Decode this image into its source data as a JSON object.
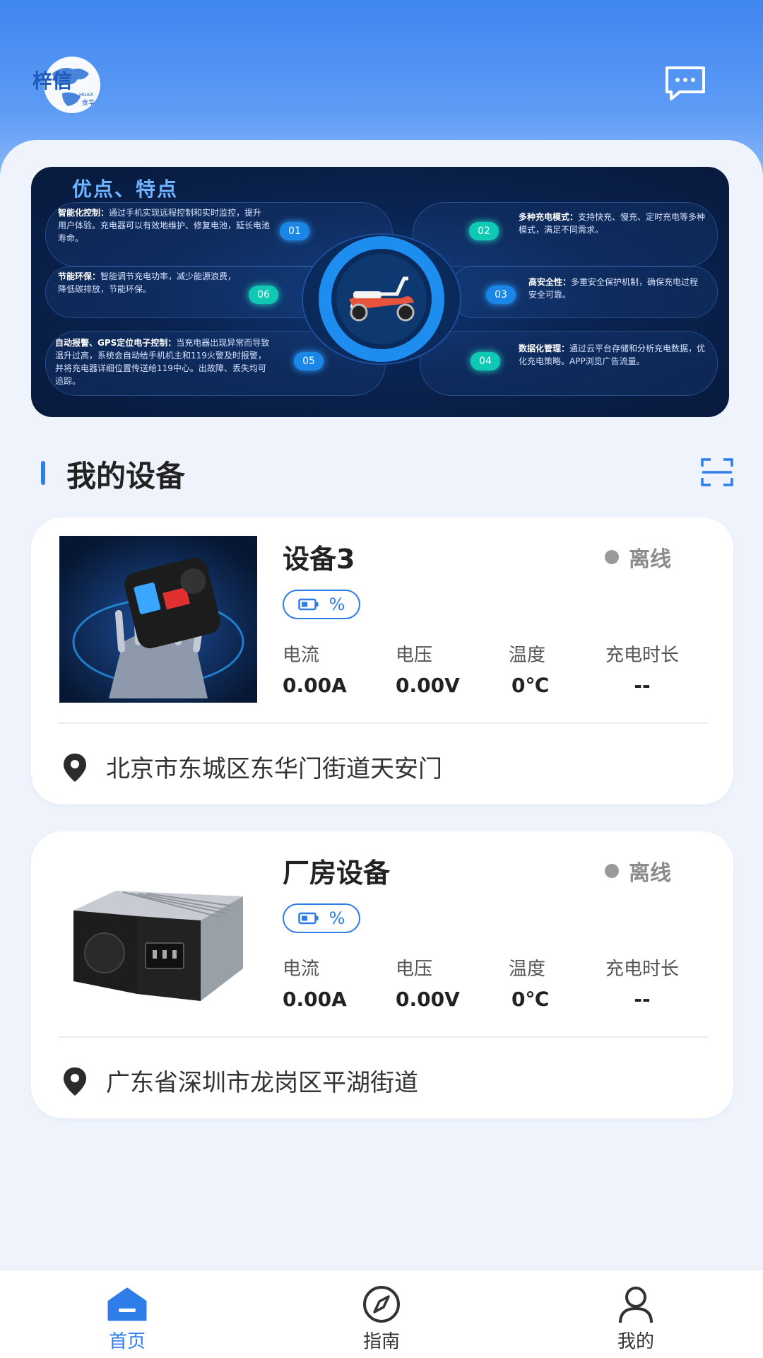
{
  "header": {
    "logo_text": "梓信",
    "logo_subtext": "HUAX 金华"
  },
  "banner": {
    "title": "优点、特点",
    "features": [
      {
        "num": "01",
        "name": "智能化控制：",
        "text": "通过手机实现远程控制和实时监控，提升用户体验。充电器可以有效地维护、修复电池，延长电池寿命。"
      },
      {
        "num": "02",
        "name": "多种充电模式：",
        "text": "支持快充、慢充、定时充电等多种模式，满足不同需求。"
      },
      {
        "num": "03",
        "name": "高安全性：",
        "text": "多重安全保护机制，确保充电过程安全可靠。"
      },
      {
        "num": "04",
        "name": "数据化管理：",
        "text": "通过云平台存储和分析充电数据，优化充电策略。APP浏览广告流量。"
      },
      {
        "num": "05",
        "name": "自动报警、GPS定位电子控制：",
        "text": "当充电器出现异常而导致温升过高，系统会自动给手机机主和119火警及时报警，并将充电器详细位置传送给119中心。出故障、丢失均可追踪。"
      },
      {
        "num": "06",
        "name": "节能环保：",
        "text": "智能调节充电功率，减少能源浪费，降低碳排放，节能环保。"
      }
    ]
  },
  "section": {
    "title": "我的设备"
  },
  "devices": [
    {
      "name": "设备3",
      "status": "离线",
      "battery_label": "%",
      "metrics": [
        {
          "label": "电流",
          "value": "0.00A"
        },
        {
          "label": "电压",
          "value": "0.00V"
        },
        {
          "label": "温度",
          "value": "0℃"
        },
        {
          "label": "充电时长",
          "value": "--"
        }
      ],
      "location": "北京市东城区东华门街道天安门"
    },
    {
      "name": "厂房设备",
      "status": "离线",
      "battery_label": "%",
      "metrics": [
        {
          "label": "电流",
          "value": "0.00A"
        },
        {
          "label": "电压",
          "value": "0.00V"
        },
        {
          "label": "温度",
          "value": "0℃"
        },
        {
          "label": "充电时长",
          "value": "--"
        }
      ],
      "location": "广东省深圳市龙岗区平湖街道"
    }
  ],
  "nav": {
    "items": [
      {
        "label": "首页",
        "icon": "home-icon",
        "active": true
      },
      {
        "label": "指南",
        "icon": "compass-icon",
        "active": false
      },
      {
        "label": "我的",
        "icon": "user-icon",
        "active": false
      }
    ]
  },
  "colors": {
    "accent": "#2f7de9",
    "header_blue": "#3f86f0",
    "offline_gray": "#9a9a9a",
    "teal": "#10c9b4"
  }
}
